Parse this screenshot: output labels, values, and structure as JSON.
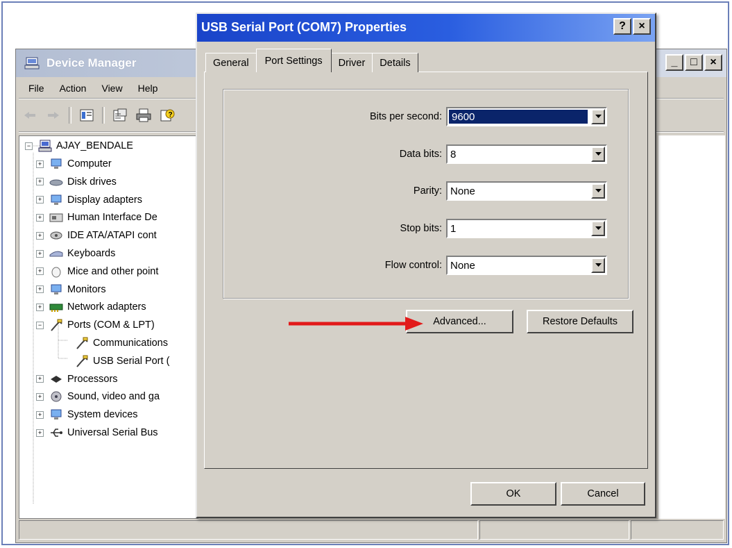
{
  "device_manager": {
    "title": "Device Manager",
    "menu": [
      "File",
      "Action",
      "View",
      "Help"
    ],
    "window_controls": [
      "_",
      "□",
      "×"
    ],
    "toolbar_icons": [
      "back-arrow-icon",
      "forward-arrow-icon",
      "console-tree-icon",
      "properties-icon",
      "print-icon",
      "help-icon"
    ],
    "tree": {
      "root": "AJAY_BENDALE",
      "items": [
        {
          "label": "Computer",
          "icon": "computer-icon"
        },
        {
          "label": "Disk drives",
          "icon": "disk-drive-icon"
        },
        {
          "label": "Display adapters",
          "icon": "display-adapter-icon"
        },
        {
          "label": "Human Interface De",
          "icon": "hid-icon"
        },
        {
          "label": "IDE ATA/ATAPI cont",
          "icon": "ide-controller-icon"
        },
        {
          "label": "Keyboards",
          "icon": "keyboard-icon"
        },
        {
          "label": "Mice and other point",
          "icon": "mouse-icon"
        },
        {
          "label": "Monitors",
          "icon": "monitor-icon"
        },
        {
          "label": "Network adapters",
          "icon": "network-adapter-icon"
        },
        {
          "label": "Ports (COM & LPT)",
          "icon": "port-icon",
          "expanded": true
        },
        {
          "label": "Communications",
          "icon": "port-icon",
          "child": true
        },
        {
          "label": "USB Serial Port (",
          "icon": "port-icon",
          "child": true
        },
        {
          "label": "Processors",
          "icon": "processor-icon"
        },
        {
          "label": "Sound, video and ga",
          "icon": "sound-icon"
        },
        {
          "label": "System devices",
          "icon": "system-device-icon"
        },
        {
          "label": "Universal Serial Bus",
          "icon": "usb-icon"
        }
      ]
    }
  },
  "dialog": {
    "title": "USB Serial Port (COM7) Properties",
    "title_controls": [
      "?",
      "×"
    ],
    "tabs": [
      "General",
      "Port Settings",
      "Driver",
      "Details"
    ],
    "active_tab": "Port Settings",
    "fields": [
      {
        "label": "Bits per second:",
        "value": "9600",
        "selected": true
      },
      {
        "label": "Data bits:",
        "value": "8"
      },
      {
        "label": "Parity:",
        "value": "None"
      },
      {
        "label": "Stop bits:",
        "value": "1"
      },
      {
        "label": "Flow control:",
        "value": "None"
      }
    ],
    "advanced_label": "Advanced...",
    "restore_label": "Restore Defaults",
    "ok_label": "OK",
    "cancel_label": "Cancel"
  },
  "colors": {
    "dialog_title": "#2a5ee0",
    "inactive_title": "#c0c9dc",
    "face": "#d4d0c8",
    "selection": "#0a246a",
    "arrow": "#e21a1a"
  }
}
